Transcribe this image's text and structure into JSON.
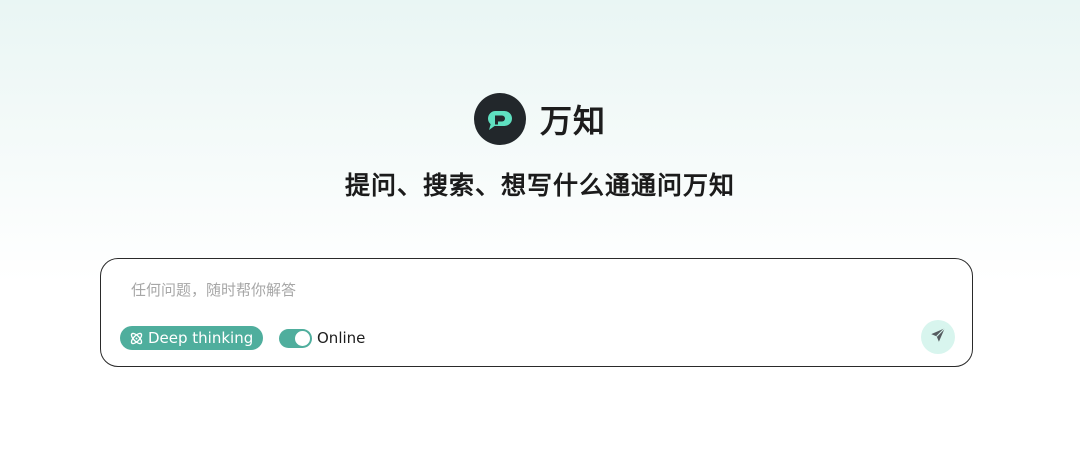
{
  "brand": {
    "name": "万知",
    "logo_icon": "chat-bubble-p-logo-icon",
    "logo_bg_color": "#22272b",
    "logo_accent_color": "#5fe0c0"
  },
  "tagline": "提问、搜索、想写什么通通问万知",
  "composer": {
    "placeholder": "任何问题，随时帮你解答",
    "value": "",
    "deep_thinking": {
      "label": "Deep thinking",
      "icon": "atom-icon",
      "active": true
    },
    "online": {
      "label": "Online",
      "enabled": true
    },
    "send_icon": "send-arrow-icon"
  },
  "colors": {
    "accent": "#4fae9d",
    "send_button_bg": "#d8f5ee",
    "border": "#2a2a2a"
  }
}
